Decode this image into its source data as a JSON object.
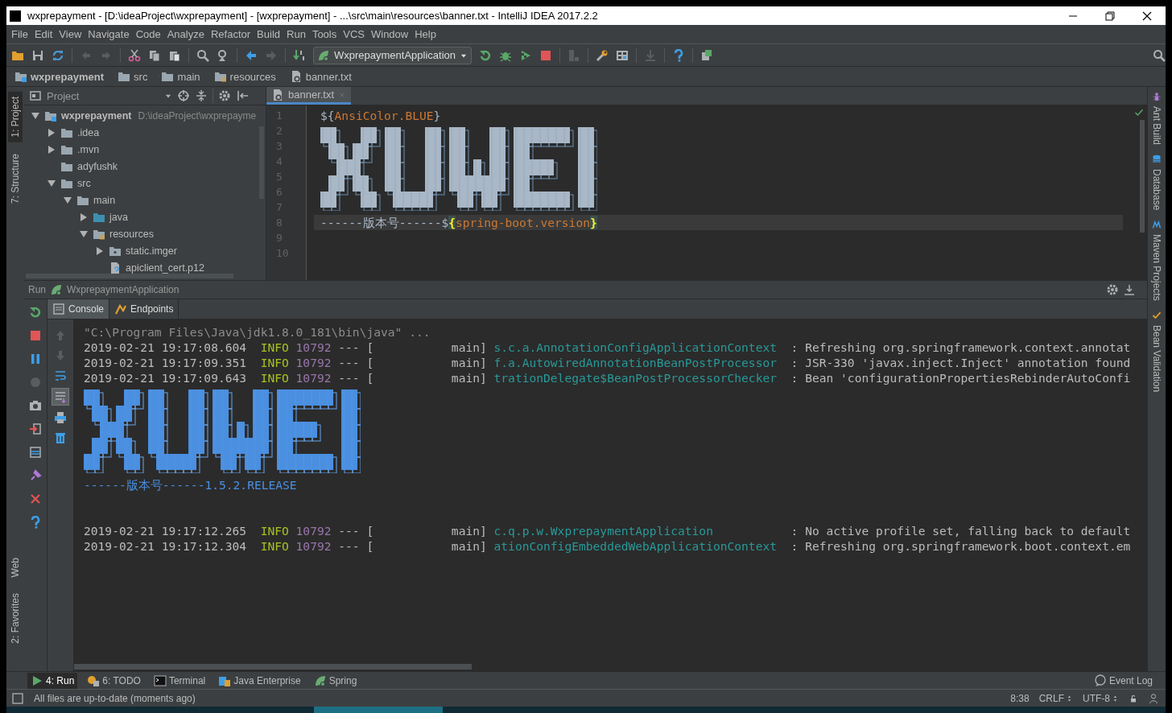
{
  "window": {
    "title": "wxprepayment - [D:\\ideaProject\\wxprepayment] - [wxprepayment] - ...\\src\\main\\resources\\banner.txt - IntelliJ IDEA 2017.2.2"
  },
  "menu": [
    "File",
    "Edit",
    "View",
    "Navigate",
    "Code",
    "Analyze",
    "Refactor",
    "Build",
    "Run",
    "Tools",
    "VCS",
    "Window",
    "Help"
  ],
  "toolbar": {
    "run_config": "WxprepaymentApplication"
  },
  "breadcrumbs": [
    {
      "label": "wxprepayment",
      "kind": "module"
    },
    {
      "label": "src",
      "kind": "folder"
    },
    {
      "label": "main",
      "kind": "folder"
    },
    {
      "label": "resources",
      "kind": "resources"
    },
    {
      "label": "banner.txt",
      "kind": "file"
    }
  ],
  "left_stripe": [
    {
      "label": "1: Project",
      "kind": "top",
      "selected": true
    },
    {
      "label": "7: Structure",
      "kind": "top",
      "selected": false
    },
    {
      "label": "Web",
      "kind": "bottom",
      "selected": false
    },
    {
      "label": "2: Favorites",
      "kind": "bottom",
      "selected": false
    }
  ],
  "right_stripe": [
    "Ant Build",
    "Database",
    "Maven Projects",
    "Bean Validation"
  ],
  "project": {
    "title": "Project",
    "tree": [
      {
        "label": "wxprepayment",
        "path": "D:\\ideaProject\\wxprepayme",
        "kind": "module",
        "expanded": true,
        "children": [
          {
            "label": ".idea",
            "kind": "folder",
            "expanded": false
          },
          {
            "label": ".mvn",
            "kind": "folder",
            "expanded": false
          },
          {
            "label": "adyfushk",
            "kind": "folder"
          },
          {
            "label": "src",
            "kind": "folder",
            "expanded": true,
            "children": [
              {
                "label": "main",
                "kind": "folder",
                "expanded": true,
                "children": [
                  {
                    "label": "java",
                    "kind": "source",
                    "expanded": false
                  },
                  {
                    "label": "resources",
                    "kind": "resources",
                    "expanded": true,
                    "children": [
                      {
                        "label": "static.imger",
                        "kind": "package",
                        "expanded": false
                      },
                      {
                        "label": "apiclient_cert.p12",
                        "kind": "file"
                      }
                    ]
                  }
                ]
              }
            ]
          }
        ]
      }
    ]
  },
  "editor": {
    "tabs": [
      {
        "label": "banner.txt",
        "selected": true
      }
    ],
    "gutter": [
      "1",
      "2",
      "3",
      "4",
      "5",
      "6",
      "7",
      "8",
      "9",
      "10"
    ],
    "lines": [
      {
        "kind": "code",
        "current": false,
        "parts": [
          {
            "text": "${",
            "kind": "plain"
          },
          {
            "text": "AnsiColor.BLUE",
            "kind": "key"
          },
          {
            "text": "}",
            "kind": "plain"
          }
        ]
      },
      {
        "kind": "art"
      },
      {
        "kind": "code",
        "current": true,
        "parts": [
          {
            "text": "------版本号------$",
            "kind": "plain"
          },
          {
            "text": "{",
            "kind": "brace"
          },
          {
            "text": "spring-boot.version",
            "kind": "key"
          },
          {
            "text": "}",
            "kind": "brace"
          }
        ]
      }
    ]
  },
  "run": {
    "title": "Run",
    "config": "WxprepaymentApplication",
    "tabs": [
      {
        "label": "Console",
        "selected": true
      },
      {
        "label": "Endpoints",
        "selected": false
      }
    ],
    "console": [
      {
        "kind": "command",
        "text": "\"C:\\Program Files\\Java\\jdk1.8.0_181\\bin\\java\" ..."
      },
      {
        "kind": "log",
        "time": "2019-02-21 19:17:08.604",
        "level": "INFO",
        "pid": "10792",
        "sep": "--- [",
        "thread": "main]",
        "logger": "s.c.a.AnnotationConfigApplicationContext",
        "message": ": Refreshing org.springframework.context.annotat"
      },
      {
        "kind": "log",
        "time": "2019-02-21 19:17:09.351",
        "level": "INFO",
        "pid": "10792",
        "sep": "--- [",
        "thread": "main]",
        "logger": "f.a.AutowiredAnnotationBeanPostProcessor",
        "message": ": JSR-330 'javax.inject.Inject' annotation found"
      },
      {
        "kind": "log",
        "time": "2019-02-21 19:17:09.643",
        "level": "INFO",
        "pid": "10792",
        "sep": "--- [",
        "thread": "main]",
        "logger": "trationDelegate$BeanPostProcessorChecker",
        "message": ": Bean 'configurationPropertiesRebinderAutoConfi"
      },
      {
        "kind": "art"
      },
      {
        "kind": "version",
        "text": "------版本号------1.5.2.RELEASE"
      },
      {
        "kind": "log",
        "time": "2019-02-21 19:17:12.265",
        "level": "INFO",
        "pid": "10792",
        "sep": "--- [",
        "thread": "main]",
        "logger": "c.q.p.w.WxprepaymentApplication",
        "message": ": No active profile set, falling back to default"
      },
      {
        "kind": "log",
        "time": "2019-02-21 19:17:12.304",
        "level": "INFO",
        "pid": "10792",
        "sep": "--- [",
        "thread": "main]",
        "logger": "ationConfigEmbeddedWebApplicationContext",
        "message": ": Refreshing org.springframework.boot.context.em"
      }
    ]
  },
  "bottom_tools": [
    {
      "label": "4: Run",
      "kind": "run",
      "selected": true
    },
    {
      "label": "6: TODO",
      "kind": "todo",
      "selected": false
    },
    {
      "label": "Terminal",
      "kind": "terminal",
      "selected": false
    },
    {
      "label": "Java Enterprise",
      "kind": "javaee",
      "selected": false
    },
    {
      "label": "Spring",
      "kind": "spring",
      "selected": false
    }
  ],
  "event_log": "Event Log",
  "status": {
    "message": "All files are up-to-date (moments ago)",
    "position": "8:38",
    "line_separator": "CRLF",
    "encoding": "UTF-8"
  }
}
